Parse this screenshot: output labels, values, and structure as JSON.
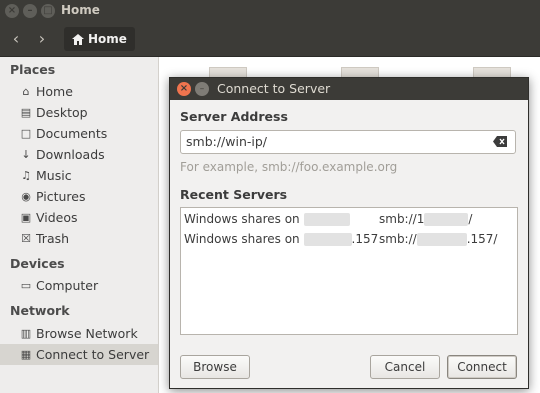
{
  "window": {
    "title": "Home",
    "path_button": "Home"
  },
  "sidebar": {
    "places_header": "Places",
    "places": [
      {
        "label": "Home",
        "icon": "home-icon"
      },
      {
        "label": "Desktop",
        "icon": "folder-icon"
      },
      {
        "label": "Documents",
        "icon": "documents-icon"
      },
      {
        "label": "Downloads",
        "icon": "downloads-icon"
      },
      {
        "label": "Music",
        "icon": "music-icon"
      },
      {
        "label": "Pictures",
        "icon": "camera-icon"
      },
      {
        "label": "Videos",
        "icon": "video-icon"
      },
      {
        "label": "Trash",
        "icon": "trash-icon"
      }
    ],
    "devices_header": "Devices",
    "devices": [
      {
        "label": "Computer",
        "icon": "drive-icon"
      }
    ],
    "network_header": "Network",
    "network": [
      {
        "label": "Browse Network",
        "icon": "network-icon"
      },
      {
        "label": "Connect to Server",
        "icon": "server-icon",
        "selected": true
      }
    ]
  },
  "dialog": {
    "title": "Connect to Server",
    "server_address_label": "Server Address",
    "server_address_value": "smb://win-ip/",
    "example_hint": "For example, smb://foo.example.org",
    "recent_servers_label": "Recent Servers",
    "recent_servers": [
      {
        "name_prefix": "Windows shares on",
        "name_suffix": "",
        "uri_prefix": "smb://1",
        "uri_suffix": "/"
      },
      {
        "name_prefix": "Windows shares on",
        "name_suffix": ".157",
        "uri_prefix": "smb://",
        "uri_suffix": ".157/"
      }
    ],
    "browse_label": "Browse",
    "cancel_label": "Cancel",
    "connect_label": "Connect"
  }
}
